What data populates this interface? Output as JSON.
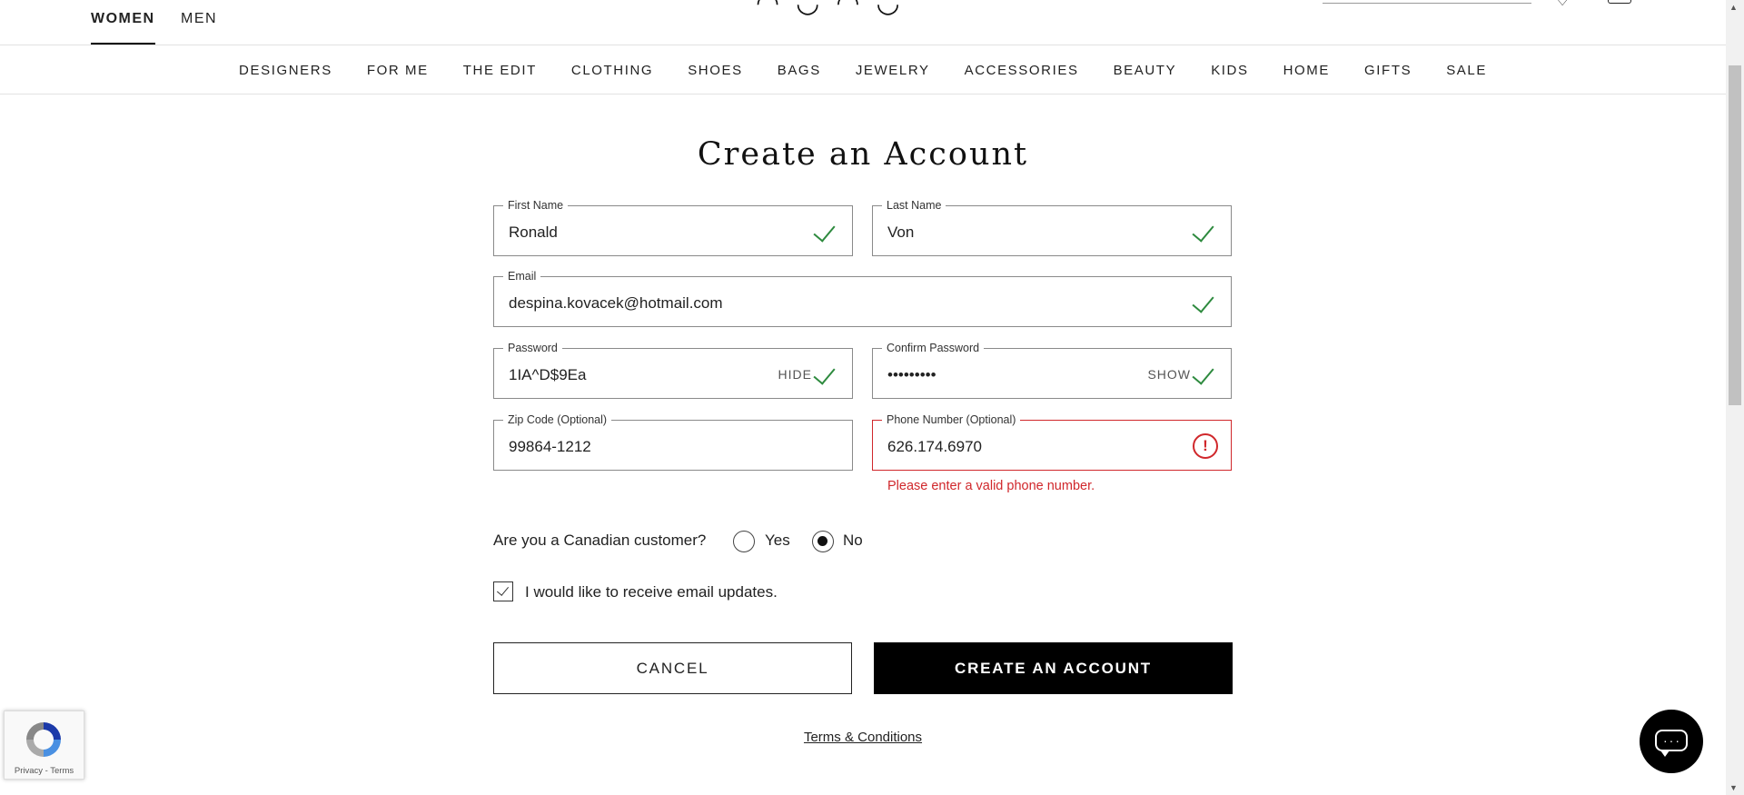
{
  "header": {
    "tabs": [
      {
        "label": "WOMEN",
        "active": true
      },
      {
        "label": "MEN",
        "active": false
      }
    ]
  },
  "nav": {
    "categories": [
      "DESIGNERS",
      "FOR ME",
      "THE EDIT",
      "CLOTHING",
      "SHOES",
      "BAGS",
      "JEWELRY",
      "ACCESSORIES",
      "BEAUTY",
      "KIDS",
      "HOME",
      "GIFTS",
      "SALE"
    ]
  },
  "form": {
    "title": "Create an Account",
    "first_name": {
      "label": "First Name",
      "value": "Ronald"
    },
    "last_name": {
      "label": "Last Name",
      "value": "Von"
    },
    "email": {
      "label": "Email",
      "value": "despina.kovacek@hotmail.com"
    },
    "password": {
      "label": "Password",
      "value": "1IA^D$9Ea",
      "toggle": "HIDE"
    },
    "confirm_password": {
      "label": "Confirm Password",
      "value": "•••••••••",
      "toggle": "SHOW"
    },
    "zip": {
      "label": "Zip Code (Optional)",
      "value": "99864-1212"
    },
    "phone": {
      "label": "Phone Number (Optional)",
      "value": "626.174.6970",
      "error": "Please enter a valid phone number."
    },
    "canadian": {
      "question": "Are you a Canadian customer?",
      "yes": "Yes",
      "no": "No",
      "selected": "No"
    },
    "email_updates": {
      "label": "I would like to receive email updates.",
      "checked": true
    },
    "cancel_label": "CANCEL",
    "create_label": "CREATE AN ACCOUNT",
    "terms_label": "Terms & Conditions"
  },
  "recaptcha": {
    "links": "Privacy - Terms"
  },
  "colors": {
    "error": "#d0272b",
    "valid": "#2d8a3e",
    "primary": "#000000"
  }
}
